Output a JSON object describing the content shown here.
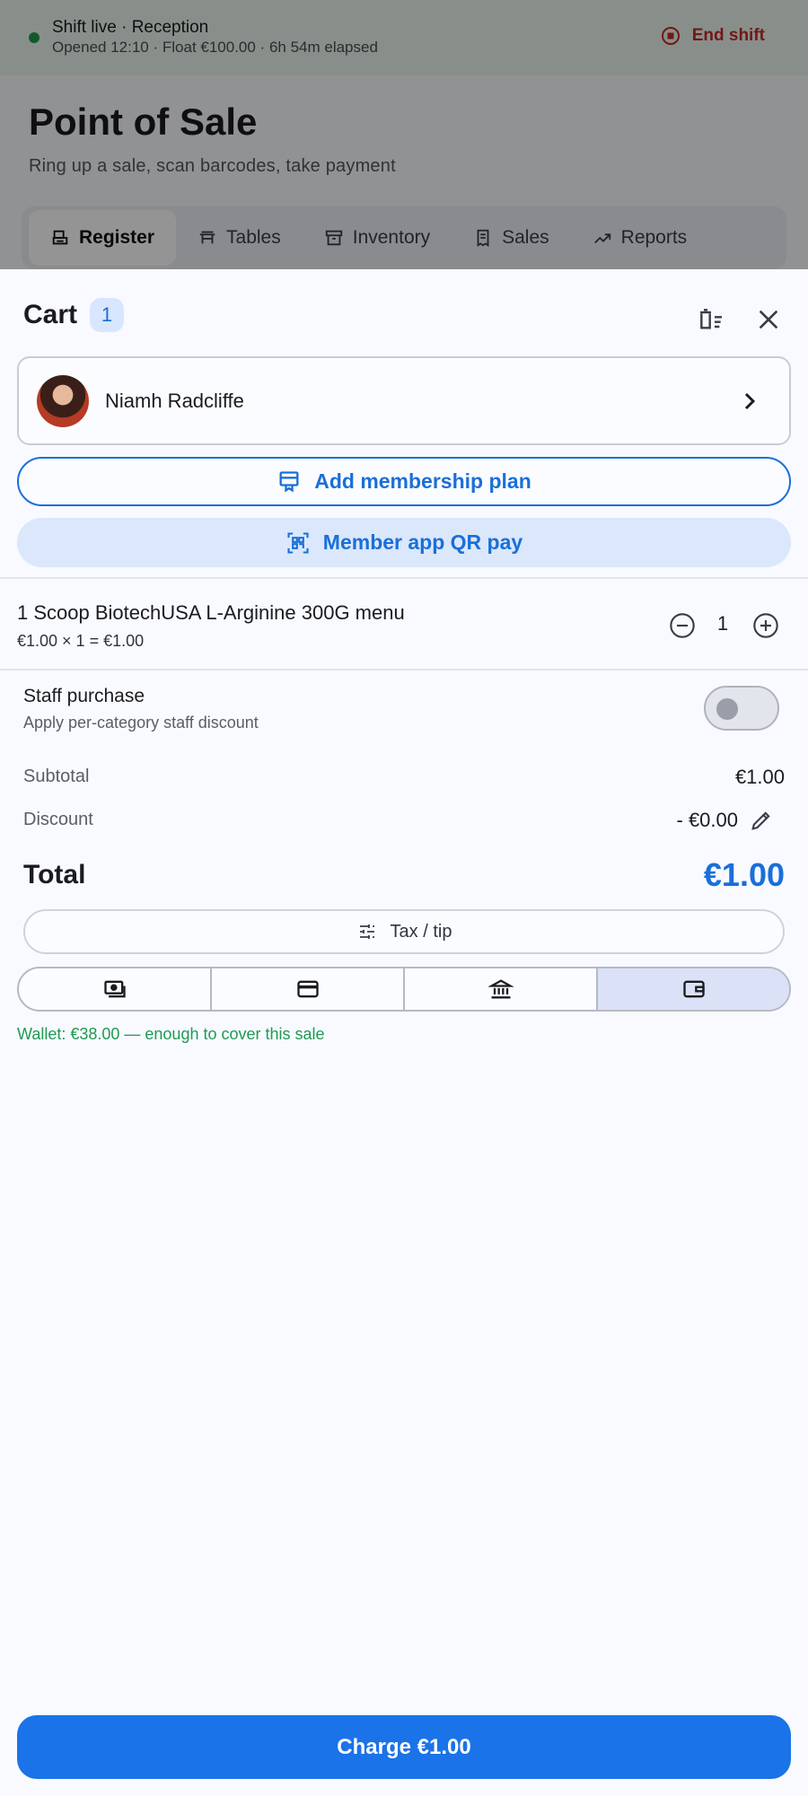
{
  "shift": {
    "title": "Shift live · Reception",
    "subtitle": "Opened 12:10 · Float €100.00 · 6h 54m elapsed",
    "end_label": "End shift",
    "status_color": "#1f9a52"
  },
  "page": {
    "title": "Point of Sale",
    "subtitle": "Ring up a sale, scan barcodes, take payment"
  },
  "tabs": [
    {
      "label": "Register",
      "icon": "register-icon",
      "active": true
    },
    {
      "label": "Tables",
      "icon": "table-icon",
      "active": false
    },
    {
      "label": "Inventory",
      "icon": "archive-icon",
      "active": false
    },
    {
      "label": "Sales",
      "icon": "receipt-icon",
      "active": false
    },
    {
      "label": "Reports",
      "icon": "trend-icon",
      "active": false
    }
  ],
  "cart": {
    "title": "Cart",
    "count": "1",
    "customer_name": "Niamh Radcliffe",
    "add_membership_label": "Add membership plan",
    "qr_pay_label": "Member app QR pay",
    "items": [
      {
        "name": "1 Scoop BiotechUSA L-Arginine 300G menu",
        "calc": "€1.00 × 1 = €1.00",
        "qty": "1"
      }
    ],
    "staff_title": "Staff purchase",
    "staff_sub": "Apply per-category staff discount",
    "staff_enabled": false,
    "subtotal_label": "Subtotal",
    "subtotal_value": "€1.00",
    "discount_label": "Discount",
    "discount_value": "- €0.00",
    "total_label": "Total",
    "total_value": "€1.00",
    "tax_tip_label": "Tax / tip",
    "payment_methods": [
      {
        "icon": "cash-icon",
        "selected": false
      },
      {
        "icon": "card-icon",
        "selected": false
      },
      {
        "icon": "bank-icon",
        "selected": false
      },
      {
        "icon": "wallet-icon",
        "selected": true
      }
    ],
    "wallet_note": "Wallet: €38.00 — enough to cover this sale",
    "charge_label": "Charge €1.00"
  },
  "colors": {
    "accent": "#1a73e8",
    "success": "#1f9a52",
    "danger": "#c62828"
  }
}
